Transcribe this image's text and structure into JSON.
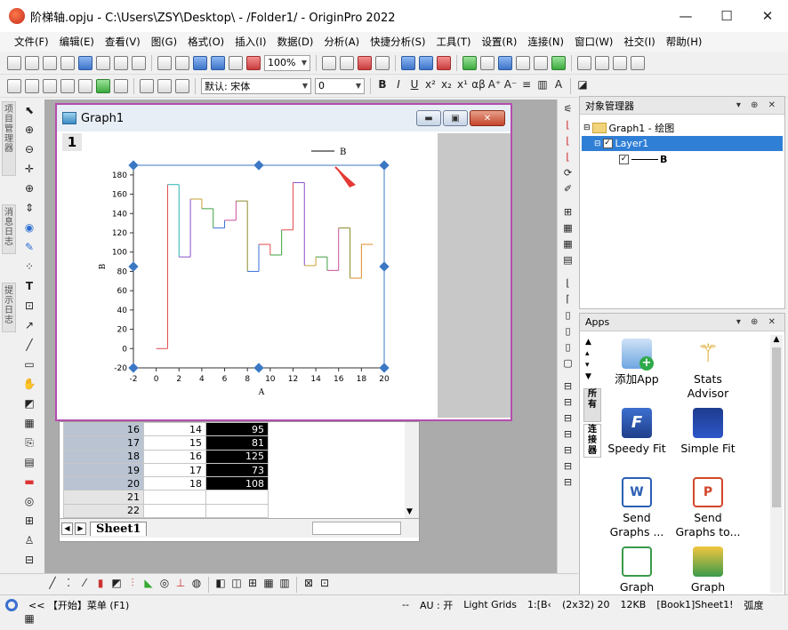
{
  "window": {
    "title": "阶梯轴.opju - C:\\Users\\ZSY\\Desktop\\ - /Folder1/ - OriginPro 2022"
  },
  "menubar": [
    "文件(F)",
    "编辑(E)",
    "查看(V)",
    "图(G)",
    "格式(O)",
    "插入(I)",
    "数据(D)",
    "分析(A)",
    "快捷分析(S)",
    "工具(T)",
    "设置(R)",
    "连接(N)",
    "窗口(W)",
    "社交(I)",
    "帮助(H)"
  ],
  "toolbar": {
    "zoom": "100%",
    "font_name": "默认: 宋体",
    "font_size": "0"
  },
  "left_tabs": [
    "项目管理器",
    "消息日志",
    "提示日志"
  ],
  "graph_window": {
    "title": "Graph1",
    "layer_number": "1",
    "legend_label": "B"
  },
  "chart_data": {
    "type": "line",
    "style": "step",
    "x": [
      0,
      1,
      2,
      3,
      4,
      5,
      6,
      7,
      8,
      9,
      10,
      11,
      12,
      13,
      14,
      15,
      16,
      17,
      18
    ],
    "series": [
      {
        "name": "B",
        "values": [
          0,
          170,
          95,
          155,
          145,
          125,
          133,
          153,
          80,
          108,
          97,
          123,
          172,
          86,
          95,
          81,
          125,
          73,
          108
        ]
      }
    ],
    "xlabel": "A",
    "ylabel": "B",
    "xlim": [
      -2,
      20
    ],
    "ylim": [
      -20,
      190
    ],
    "xticks": [
      "-2",
      "0",
      "2",
      "4",
      "6",
      "8",
      "10",
      "12",
      "14",
      "16",
      "18",
      "20"
    ],
    "yticks": [
      "-20",
      "0",
      "20",
      "40",
      "60",
      "80",
      "100",
      "120",
      "140",
      "160",
      "180"
    ],
    "segment_colors": [
      "#555555",
      "#e24a4a",
      "#2bb3b3",
      "#8a4fc9",
      "#c9a030",
      "#3fa040",
      "#3a6fd8",
      "#c94f9a",
      "#8a8a2a",
      "#3a6fd8",
      "#e24a4a",
      "#3fa040",
      "#e24a4a",
      "#8a4fc9",
      "#c9a030",
      "#3fa040",
      "#c94f9a",
      "#8a8a2a",
      "#e08a2a"
    ]
  },
  "sheet": {
    "rows": [
      {
        "row": "16",
        "a": "14",
        "b": "95"
      },
      {
        "row": "17",
        "a": "15",
        "b": "81"
      },
      {
        "row": "18",
        "a": "16",
        "b": "125"
      },
      {
        "row": "19",
        "a": "17",
        "b": "73"
      },
      {
        "row": "20",
        "a": "18",
        "b": "108"
      },
      {
        "row": "21",
        "a": "",
        "b": ""
      },
      {
        "row": "22",
        "a": "",
        "b": ""
      }
    ],
    "tab_name": "Sheet1"
  },
  "object_manager": {
    "title": "对象管理器",
    "graph_node": "Graph1 - 绘图",
    "layer_node": "Layer1",
    "plot_node": "B"
  },
  "apps_panel": {
    "title": "Apps",
    "tab_all": "所有",
    "tab_connect": "连接器",
    "items": [
      "添加App",
      "Stats Advisor",
      "Speedy Fit",
      "Simple Fit",
      "Send Graphs ...",
      "Send Graphs to...",
      "Graph",
      "Graph"
    ]
  },
  "statusbar": {
    "hint": "<< 【开始】菜单 (F1)",
    "dash": "--",
    "au": "AU : 开",
    "grids": "Light Grids",
    "scale": "1:[B‹",
    "dims": "(2x32) 20",
    "size": "12KB",
    "book": "[Book1]Sheet1!",
    "angle": "弧度"
  },
  "colors": {
    "accent": "#3b78c4",
    "graph_border": "#b44dae",
    "selection": "#2f7fd6",
    "arrow": "#e53935"
  }
}
